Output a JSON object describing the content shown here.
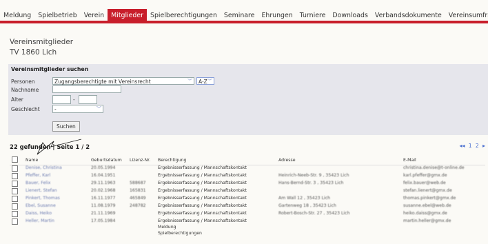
{
  "nav": {
    "items": [
      "Meldung",
      "Spielbetrieb",
      "Verein",
      "Mitglieder",
      "Spielberechtigungen",
      "Seminare",
      "Ehrungen",
      "Turniere",
      "Downloads",
      "Verbandsdokumente",
      "Vereinsumfragen"
    ],
    "active_index": 3
  },
  "page": {
    "title": "Vereinsmitglieder",
    "club": "TV 1860 Lich"
  },
  "search": {
    "title": "Vereinsmitglieder suchen",
    "labels": {
      "personen": "Personen",
      "nachname": "Nachname",
      "alter": "Alter",
      "geschlecht": "Geschlecht"
    },
    "personen_value": "Zugangsberechtigte mit Vereinsrecht",
    "sort_value": "A-Z",
    "alter_separator": "-",
    "geschlecht_value": "-",
    "button": "Suchen"
  },
  "results": {
    "summary": "22 gefunden | Seite 1 / 2",
    "pager": [
      "◂◂",
      "1",
      "2",
      "▸"
    ]
  },
  "table": {
    "headers": [
      "Name",
      "Geburtsdatum",
      "Lizenz-Nr.",
      "Berechtigung",
      "Adresse",
      "E-Mail"
    ],
    "berechtigung": "Ergebnisserfassung / Mannschaftskontakt",
    "extra_lines": [
      "Meldung",
      "Spielberechtigungen"
    ],
    "rows": [
      {
        "name": "Denise, Christina",
        "geb": "20.05.1994",
        "liz": "",
        "adr": "",
        "mail": "christina.denise@t-online.de"
      },
      {
        "name": "Pfeffer, Karl",
        "geb": "16.04.1951",
        "liz": "",
        "adr": "Heinrich-Neeb-Str. 9 , 35423 Lich",
        "mail": "karl.pfeffer@gmx.de"
      },
      {
        "name": "Bauer, Felix",
        "geb": "29.11.1963",
        "liz": "588687",
        "adr": "Hans-Bernd-Str. 3 , 35423 Lich",
        "mail": "felix.bauer@web.de"
      },
      {
        "name": "Lienert, Stefan",
        "geb": "20.02.1968",
        "liz": "165831",
        "adr": "",
        "mail": "stefan.lienert@gmx.de"
      },
      {
        "name": "Pinkert, Thomas",
        "geb": "16.11.1977",
        "liz": "465849",
        "adr": "Am Wall 12 , 35423 Lich",
        "mail": "thomas.pinkert@gmx.de"
      },
      {
        "name": "Ebel, Susanne",
        "geb": "11.08.1979",
        "liz": "248782",
        "adr": "Gartenweg 18 , 35423 Lich",
        "mail": "susanne.ebel@web.de"
      },
      {
        "name": "Daiss, Heiko",
        "geb": "21.11.1969",
        "liz": "",
        "adr": "Robert-Bosch-Str. 27 , 35423 Lich",
        "mail": "heiko.daiss@gmx.de"
      },
      {
        "name": "Heller, Martin",
        "geb": "17.05.1984",
        "liz": "",
        "adr": "",
        "mail": "martin.heller@gmx.de"
      }
    ]
  },
  "colors": {
    "accent": "#c81e2b",
    "link": "#4a6fd0",
    "panel": "#e6e6ec"
  }
}
